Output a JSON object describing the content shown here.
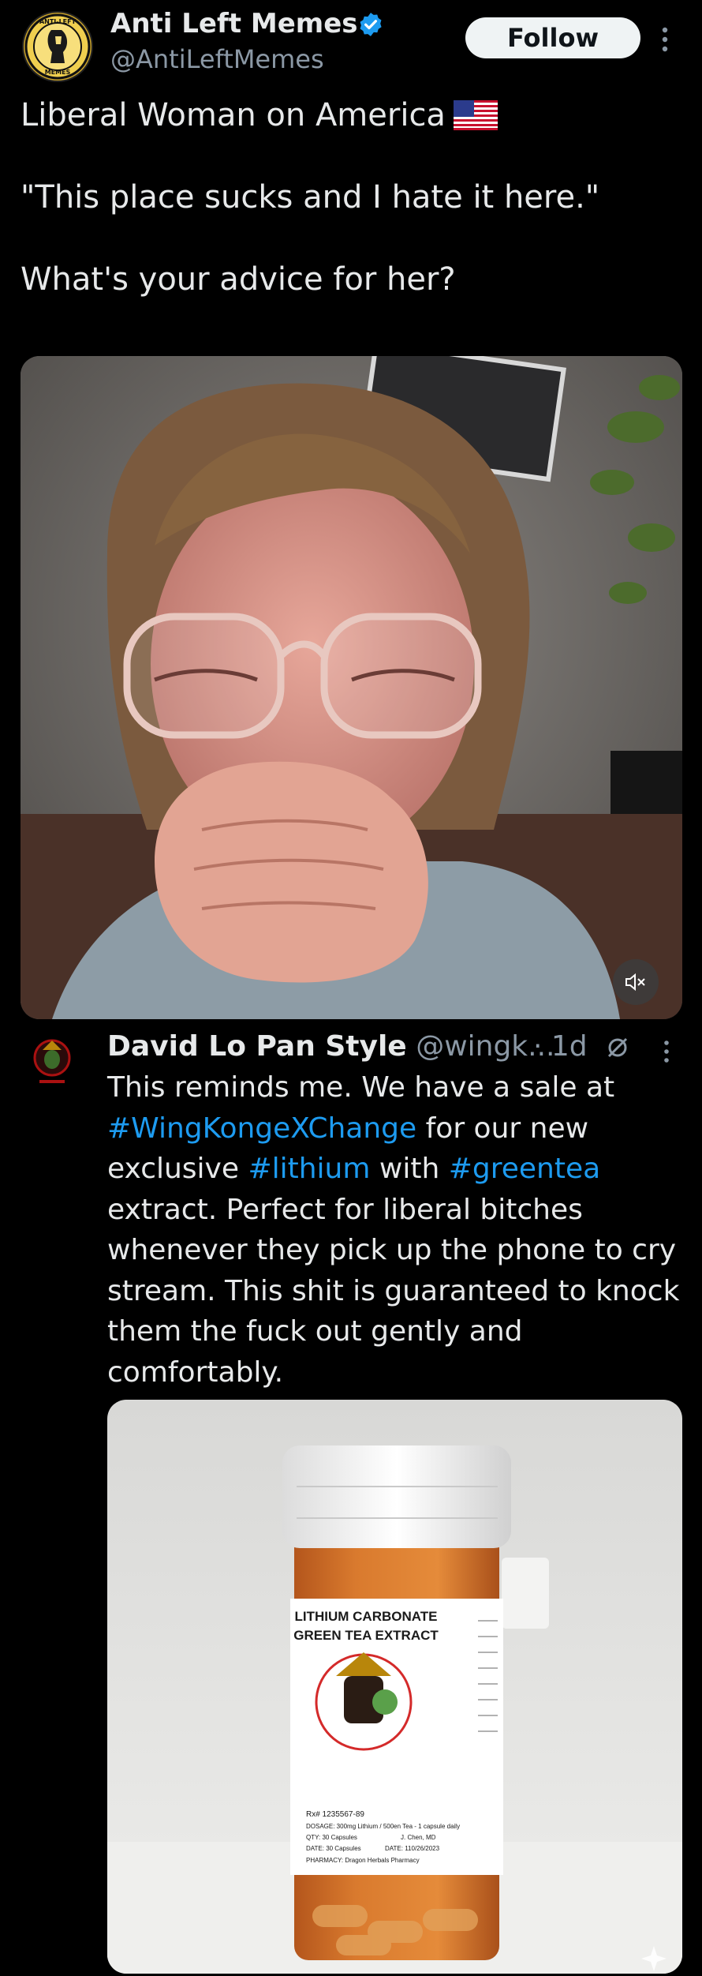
{
  "author": {
    "name": "Anti Left Memes",
    "handle": "@AntiLeftMemes",
    "avatar_text_top": "ANTI-LEFT",
    "avatar_text_bottom": "MEMES"
  },
  "follow_label": "Follow",
  "tweet": {
    "line1": "Liberal Woman on America",
    "line2": "\"This place sucks and I hate it here.\"",
    "line3": "What's your advice for her?"
  },
  "reply": {
    "name": "David Lo Pan Style",
    "handle": "@wingk...",
    "time": "· 1d",
    "lines": [
      [
        {
          "t": "This reminds me. We have a sale at"
        }
      ],
      [
        {
          "t": "#WingKongeXChange",
          "tag": true
        },
        {
          "t": " for our new"
        }
      ],
      [
        {
          "t": "exclusive "
        },
        {
          "t": "#lithium",
          "tag": true
        },
        {
          "t": " with "
        },
        {
          "t": "#greentea",
          "tag": true
        }
      ],
      [
        {
          "t": "extract. Perfect for liberal bitches"
        }
      ],
      [
        {
          "t": "whenever they pick up the phone to cry"
        }
      ],
      [
        {
          "t": "stream. This shit is guaranteed to knock"
        }
      ],
      [
        {
          "t": "them the fuck out gently and"
        }
      ],
      [
        {
          "t": "comfortably."
        }
      ]
    ]
  },
  "bottle_label": {
    "title1": "LITHIUM CARBONATE",
    "title2": "GREEN TEA EXTRACT",
    "rx": "Rx# 1235567-89",
    "dosage": "DOSAGE: 300mg Lithium / 500en Tea - 1 capsule daily",
    "qty": "QTY: 30 Capsules",
    "doctor": "J. Chen, MD",
    "date_fill": "DATE: 30 Capsules",
    "date": "DATE: 110/26/2023",
    "pharmacy": "PHARMACY: Dragon Herbals Pharmacy"
  },
  "colors": {
    "background": "#000000",
    "text": "#e7e9ea",
    "secondary": "#8b98a5",
    "link": "#1d9bf0",
    "verified": "#1d9bf0"
  }
}
